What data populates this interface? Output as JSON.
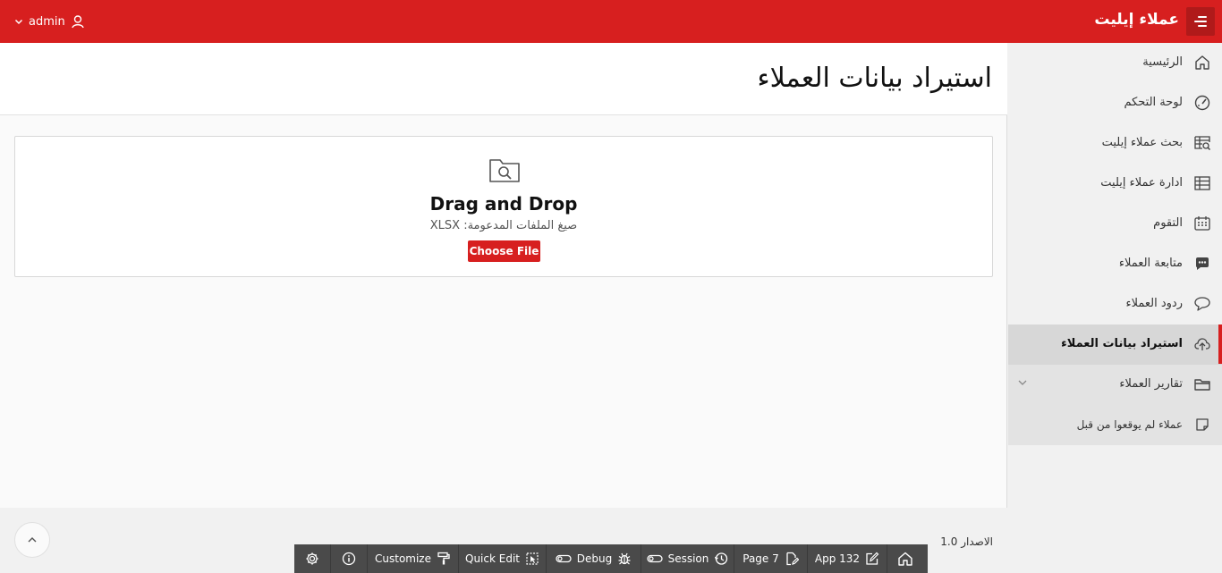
{
  "header": {
    "app_title": "عملاء إيليت",
    "user": "admin",
    "icons": {
      "menu": "hamburger-icon",
      "user": "user-icon",
      "caret": "chevron-down-icon"
    }
  },
  "page": {
    "title": "استيراد بيانات العملاء"
  },
  "upload": {
    "title": "Drag and Drop",
    "supported": "صيغ الملفات المدعومة: XLSX",
    "button": "Choose File",
    "icon": "folder-search-icon"
  },
  "sidebar": {
    "items": [
      {
        "label": "الرئيسية",
        "icon": "home-icon"
      },
      {
        "label": "لوحة التحكم",
        "icon": "gauge-icon"
      },
      {
        "label": "بحث عملاء إيليت",
        "icon": "table-search-icon"
      },
      {
        "label": "ادارة عملاء إيليت",
        "icon": "table-icon"
      },
      {
        "label": "التقوم",
        "icon": "calendar-icon"
      },
      {
        "label": "متابعة العملاء",
        "icon": "chat-icon"
      },
      {
        "label": "ردود العملاء",
        "icon": "comment-icon"
      },
      {
        "label": "استيراد بيانات العملاء",
        "icon": "cloud-upload-icon",
        "active": true
      },
      {
        "label": "تقارير العملاء",
        "icon": "folder-icon",
        "expanded": true
      },
      {
        "label": "عملاء لم يوقعوا من قبل",
        "icon": "note-icon"
      }
    ]
  },
  "footer": {
    "version": "الاصدار 1.0"
  },
  "devbar": {
    "items": [
      {
        "label": "",
        "icon": "home-icon"
      },
      {
        "label": "App 132",
        "icon": "edit-icon"
      },
      {
        "label": "Page 7",
        "icon": "page-edit-icon"
      },
      {
        "label": "Session",
        "icon": "clock-icon"
      },
      {
        "label": "Debug",
        "icon": "bug-icon"
      },
      {
        "label": "Quick Edit",
        "icon": "cursor-icon"
      },
      {
        "label": "Customize",
        "icon": "paint-roller-icon"
      },
      {
        "label": "",
        "icon": "info-icon"
      },
      {
        "label": "",
        "icon": "gear-icon"
      }
    ]
  },
  "colors": {
    "accent": "#d71f1f",
    "header_bg": "#d71f1f",
    "sidebar_bg": "#f1f1f1",
    "active_bg": "#d7d7d7",
    "devbar_bg": "#4a4a4a"
  }
}
